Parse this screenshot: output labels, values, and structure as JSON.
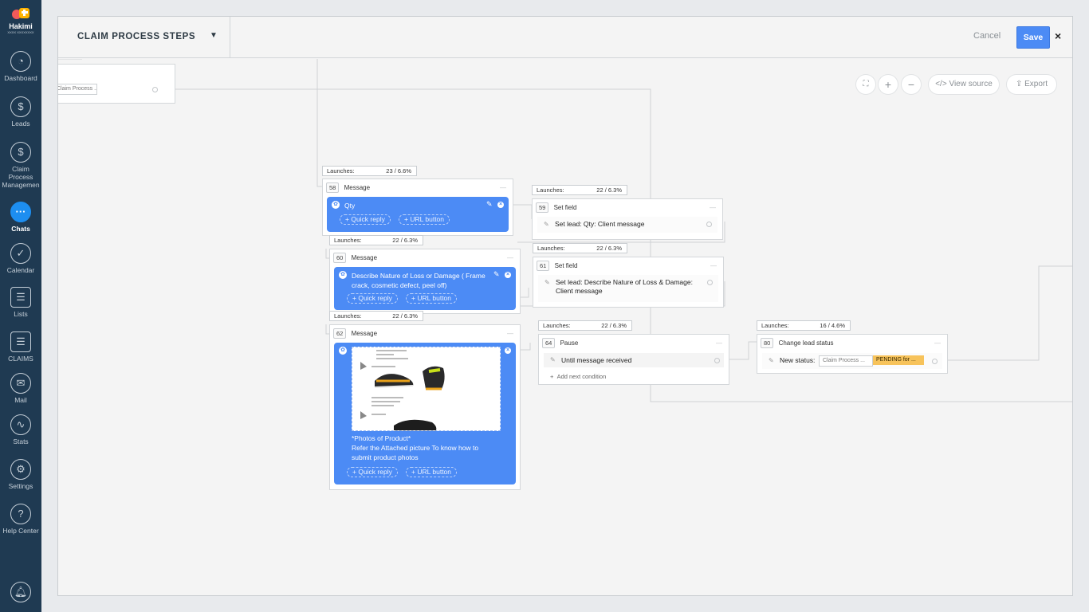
{
  "logo": {
    "name": "Hakimi",
    "tagline": "XXXX XXXXXXXX"
  },
  "sidebar": {
    "items": [
      {
        "label": "Dashboard",
        "icon": "dashboard-icon"
      },
      {
        "label": "Leads",
        "icon": "dollar-icon"
      },
      {
        "label": "Claim Process Managemen",
        "icon": "dollar-icon"
      },
      {
        "label": "Chats",
        "icon": "chat-icon",
        "active": true
      },
      {
        "label": "Calendar",
        "icon": "check-icon"
      },
      {
        "label": "Lists",
        "icon": "list-icon"
      },
      {
        "label": "CLAIMS",
        "icon": "list-icon"
      },
      {
        "label": "Mail",
        "icon": "mail-icon"
      },
      {
        "label": "Stats",
        "icon": "stats-icon"
      },
      {
        "label": "Settings",
        "icon": "wrench-icon"
      },
      {
        "label": "Help Center",
        "icon": "help-icon"
      }
    ],
    "bell_icon": "bell-icon"
  },
  "header": {
    "title": "CLAIM PROCESS STEPS",
    "cancel": "Cancel",
    "save": "Save",
    "close": "×"
  },
  "toolbar": {
    "view_source": "View source",
    "export": "Export"
  },
  "canvas": {
    "top_left_field": "Claim Process ...",
    "node58": {
      "launches_label": "Launches:",
      "launches_value": "23 / 6.6%",
      "num": "58",
      "type": "Message",
      "text": "Qty",
      "quick_reply": "Quick reply",
      "url_button": "URL button"
    },
    "node59": {
      "launches_label": "Launches:",
      "launches_value": "22 / 6.3%",
      "num": "59",
      "type": "Set field",
      "row": "Set lead: Qty: Client message"
    },
    "node60": {
      "launches_label": "Launches:",
      "launches_value": "22 / 6.3%",
      "num": "60",
      "type": "Message",
      "text": "Describe Nature of Loss or Damage ( Frame crack, cosmetic defect, peel off)",
      "quick_reply": "Quick reply",
      "url_button": "URL button"
    },
    "node61": {
      "launches_label": "Launches:",
      "launches_value": "22 / 6.3%",
      "num": "61",
      "type": "Set field",
      "row": "Set lead: Describe Nature of Loss & Damage: Client message"
    },
    "node62": {
      "launches_label": "Launches:",
      "launches_value": "22 / 6.3%",
      "num": "62",
      "type": "Message",
      "text_line1": "*Photos of Product*",
      "text_line2": "Refer the Attached picture To know how to submit product photos",
      "quick_reply": "Quick reply",
      "url_button": "URL button"
    },
    "node64": {
      "launches_label": "Launches:",
      "launches_value": "22 / 6.3%",
      "num": "64",
      "type": "Pause",
      "row": "Until message received",
      "add": "Add next condition"
    },
    "node80": {
      "launches_label": "Launches:",
      "launches_value": "16 / 4.6%",
      "num": "80",
      "type": "Change lead status",
      "status_label": "New status:",
      "status_pipeline": "Claim Process ...",
      "status_value": "PENDING for ..."
    }
  },
  "colors": {
    "accent": "#4c8bf5",
    "sidebar": "#1f3a52",
    "pending": "#f7c35b"
  }
}
